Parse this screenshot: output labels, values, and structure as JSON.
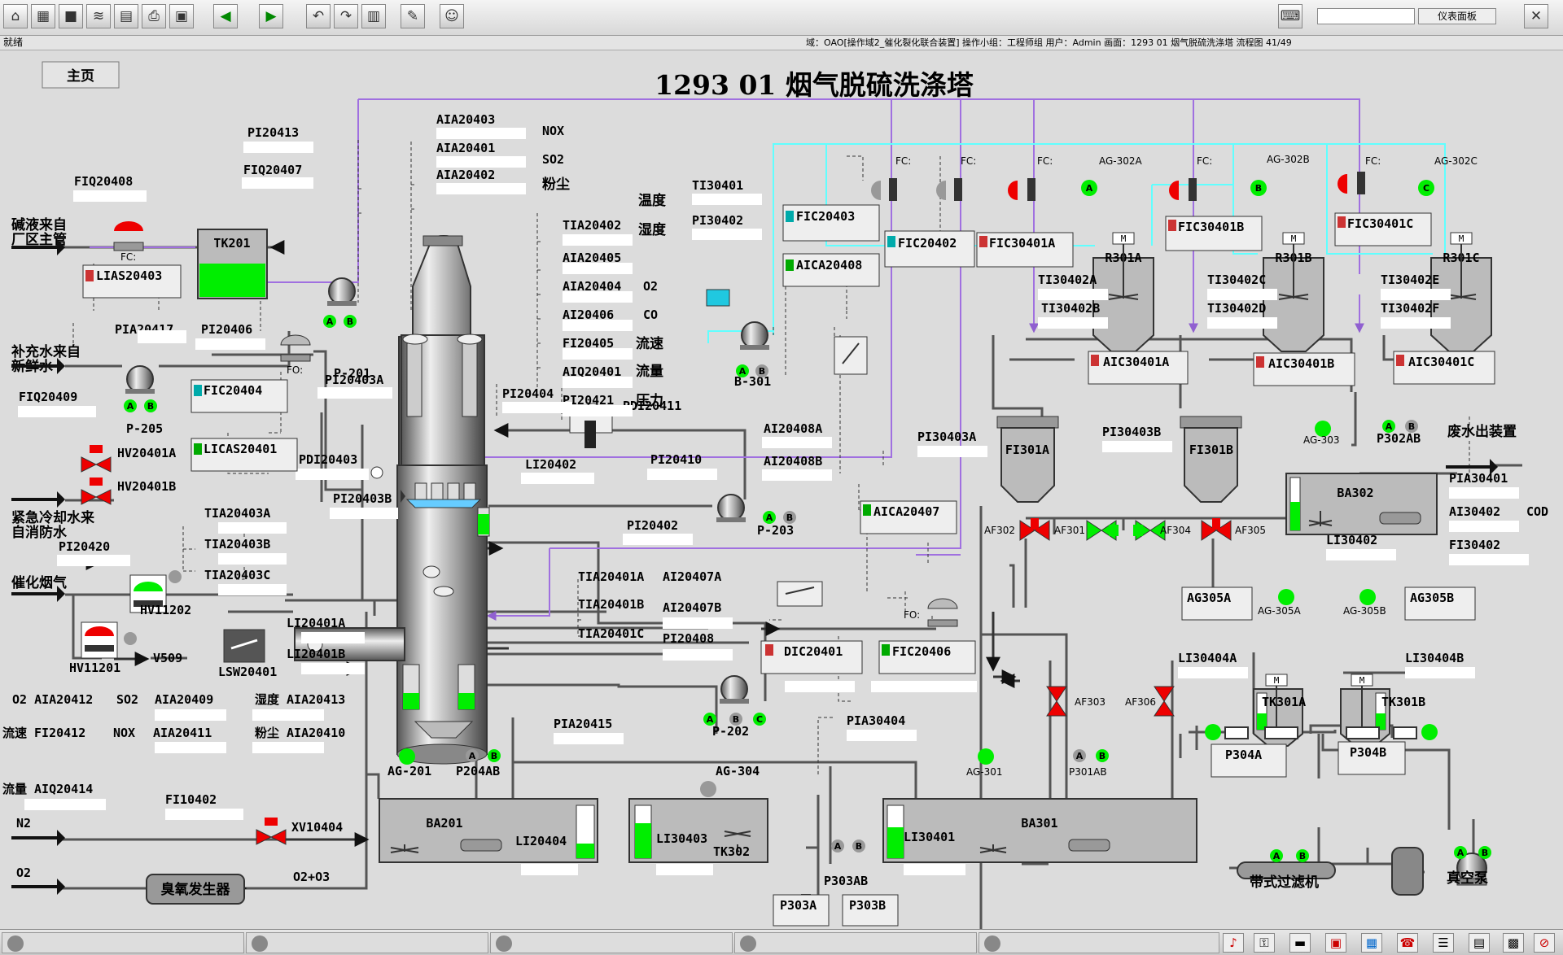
{
  "status_left": "就绪",
  "status_info": "域：OAO[操作域2_催化裂化联合装置] 操作小组：工程师组 用户：Admin 画面：1293 01 烟气脱硫洗涤塔 流程图 41/49",
  "toolbar_panel": "仪表面板",
  "home_button": "主页",
  "title": "1293  01  烟气脱硫洗涤塔",
  "colors": {
    "pipe": "#555555",
    "purple": "#a070e0",
    "cyan": "#60ffff",
    "green_light": "#00ee00",
    "valve_red": "#ee0000",
    "vessel": "#a8a8a8"
  },
  "labels": {
    "PI20413": "PI20413",
    "FIQ20407": "FIQ20407",
    "FIQ20408": "FIQ20408",
    "caustic1": "碱液来自",
    "caustic2": "厂区主管",
    "LIAS20403": "LIAS20403",
    "TK201": "TK201",
    "P201": "P-201",
    "PIA20417": "PIA20417",
    "PI20406": "PI20406",
    "makeup1": "补充水来自",
    "makeup2": "新鲜水",
    "FIQ20409": "FIQ20409",
    "P205": "P-205",
    "FIC20404": "FIC20404",
    "PI20403A": "PI20403A",
    "HV20401A": "HV20401A",
    "HV20401B": "HV20401B",
    "LICAS20401": "LICAS20401",
    "PDI20403": "PDI20403",
    "PI20403B": "PI20403B",
    "emerg1": "紧急冷却水来",
    "emerg2": "自消防水",
    "TIA20403A": "TIA20403A",
    "TIA20403B": "TIA20403B",
    "TIA20403C": "TIA20403C",
    "PI20420": "PI20420",
    "flue": "催化烟气",
    "HV11202": "HV11202",
    "HV11201": "HV11201",
    "V509": "V509",
    "LSW20401": "LSW20401",
    "LI20401A": "LI20401A",
    "LI20401B": "LI20401B",
    "AIA20403": "AIA20403",
    "NOX": "NOX",
    "AIA20401": "AIA20401",
    "SO2": "SO2",
    "AIA20402": "AIA20402",
    "dust": "粉尘",
    "TIA20402": "TIA20402",
    "temp": "温度",
    "AIA20405": "AIA20405",
    "humid": "湿度",
    "AIA20404": "AIA20404",
    "O2": "O2",
    "AI20406": "AI20406",
    "CO": "CO",
    "FI20405": "FI20405",
    "speed": "流速",
    "AIQ20401": "AIQ20401",
    "flow": "流量",
    "PI20421": "PI20421",
    "press": "压力",
    "PI20404": "PI20404",
    "PDI20411": "PDI20411",
    "LI20402": "LI20402",
    "PI20410": "PI20410",
    "PI20402": "PI20402",
    "P203": "P-203",
    "TIA20401A": "TIA20401A",
    "TIA20401B": "TIA20401B",
    "TIA20401C": "TIA20401C",
    "AI20407A": "AI20407A",
    "AI20407B": "AI20407B",
    "PI20408": "PI20408",
    "TI30401": "TI30401",
    "PI30402": "PI30402",
    "FIC20403": "FIC20403",
    "AICA20408": "AICA20408",
    "B301": "B-301",
    "AI20408A": "AI20408A",
    "AI20408B": "AI20408B",
    "FIC20402": "FIC20402",
    "FIC30401A": "FIC30401A",
    "FIC30401B": "FIC30401B",
    "FIC30401C": "FIC30401C",
    "FC": "FC:",
    "FO": "FO:",
    "AG302A": "AG-302A",
    "AG302B": "AG-302B",
    "AG302C": "AG-302C",
    "R301A": "R301A",
    "R301B": "R301B",
    "R301C": "R301C",
    "TI30402A": "TI30402A",
    "TI30402B": "TI30402B",
    "TI30402C": "TI30402C",
    "TI30402D": "TI30402D",
    "TI30402E": "TI30402E",
    "TI30402F": "TI30402F",
    "AIC30401A": "AIC30401A",
    "AIC30401B": "AIC30401B",
    "AIC30401C": "AIC30401C",
    "PI30403A": "PI30403A",
    "PI30403B": "PI30403B",
    "FI301A": "FI301A",
    "FI301B": "FI301B",
    "AF301": "AF301",
    "AF302": "AF302",
    "AF304": "AF304",
    "AF305": "AF305",
    "AF303": "AF303",
    "AF306": "AF306",
    "AICA20407": "AICA20407",
    "DIC20401": "DIC20401",
    "FIC20406": "FIC20406",
    "AG303": "AG-303",
    "P302AB": "P302AB",
    "waste": "废水出装置",
    "BA302": "BA302",
    "PIA30401": "PIA30401",
    "AI30402": "AI30402",
    "COD": "COD",
    "FI30402": "FI30402",
    "LI30402": "LI30402",
    "AG305A": "AG305A",
    "AG305B": "AG305B",
    "AG305A2": "AG-305A",
    "AG305B2": "AG-305B",
    "LI30404A": "LI30404A",
    "LI30404B": "LI30404B",
    "TK301A": "TK301A",
    "TK301B": "TK301B",
    "P304A": "P304A",
    "P304B": "P304B",
    "belt": "带式过滤机",
    "vac": "真空泵",
    "P202": "P-202",
    "PIA20415": "PIA20415",
    "PIA30404": "PIA30404",
    "O2AIA": "O2 AIA20412",
    "SO2AIA": "SO2",
    "AIA20409": "AIA20409",
    "humAIA": "湿度 AIA20413",
    "FI20412": "流速 FI20412",
    "NOX2": "NOX",
    "AIA20411": "AIA20411",
    "dust2": "粉尘 AIA20410",
    "AIQ20414": "流量 AIQ20414",
    "AG201": "AG-201",
    "P204AB": "P204AB",
    "BA201": "BA201",
    "LI20404": "LI20404",
    "AG304": "AG-304",
    "LI20403": "LI30403",
    "TK302": "TK302",
    "P303AB": "P303AB",
    "P303A": "P303A",
    "P303B": "P303B",
    "AG301": "AG-301",
    "P301AB": "P301AB",
    "BA301": "BA301",
    "LI30401": "LI30401",
    "FI10402": "FI10402",
    "N2": "N2",
    "XV10404": "XV10404",
    "O2b": "O2",
    "ozone": "臭氧发生器",
    "O2O3": "O2+O3",
    "A": "A",
    "B": "B",
    "C": "C",
    "M": "M"
  }
}
